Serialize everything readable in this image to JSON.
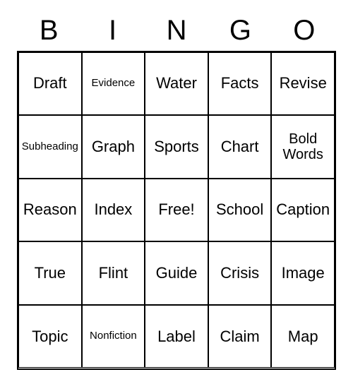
{
  "header": {
    "letters": [
      "B",
      "I",
      "N",
      "G",
      "O"
    ]
  },
  "grid": {
    "cells": [
      {
        "text": "Draft",
        "size": "normal"
      },
      {
        "text": "Evidence",
        "size": "small"
      },
      {
        "text": "Water",
        "size": "normal"
      },
      {
        "text": "Facts",
        "size": "normal"
      },
      {
        "text": "Revise",
        "size": "normal"
      },
      {
        "text": "Subheading",
        "size": "small"
      },
      {
        "text": "Graph",
        "size": "normal"
      },
      {
        "text": "Sports",
        "size": "normal"
      },
      {
        "text": "Chart",
        "size": "normal"
      },
      {
        "text": "Bold Words",
        "size": "two-line"
      },
      {
        "text": "Reason",
        "size": "normal"
      },
      {
        "text": "Index",
        "size": "normal"
      },
      {
        "text": "Free!",
        "size": "normal"
      },
      {
        "text": "School",
        "size": "normal"
      },
      {
        "text": "Caption",
        "size": "normal"
      },
      {
        "text": "True",
        "size": "normal"
      },
      {
        "text": "Flint",
        "size": "normal"
      },
      {
        "text": "Guide",
        "size": "normal"
      },
      {
        "text": "Crisis",
        "size": "normal"
      },
      {
        "text": "Image",
        "size": "normal"
      },
      {
        "text": "Topic",
        "size": "normal"
      },
      {
        "text": "Nonfiction",
        "size": "small"
      },
      {
        "text": "Label",
        "size": "normal"
      },
      {
        "text": "Claim",
        "size": "normal"
      },
      {
        "text": "Map",
        "size": "normal"
      }
    ]
  }
}
